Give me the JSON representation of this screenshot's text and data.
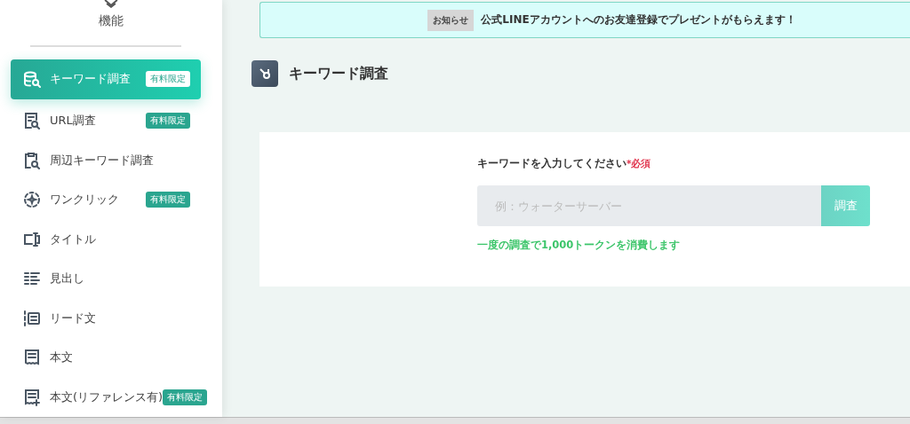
{
  "sidebar": {
    "heading": "機能",
    "items": [
      {
        "label": "キーワード調査",
        "badge": "有料限定",
        "selected": true
      },
      {
        "label": "URL調査",
        "badge": "有料限定",
        "selected": false
      },
      {
        "label": "周辺キーワード調査",
        "selected": false
      },
      {
        "label": "ワンクリック",
        "badge": "有料限定",
        "selected": false
      },
      {
        "label": "タイトル",
        "selected": false
      },
      {
        "label": "見出し",
        "selected": false
      },
      {
        "label": "リード文",
        "selected": false
      },
      {
        "label": "本文",
        "selected": false
      },
      {
        "label": "本文(リファレンス有)",
        "badge": "有料限定",
        "selected": false
      }
    ]
  },
  "notice": {
    "tag": "お知らせ",
    "text": "公式LINEアカウントへのお友達登録でプレゼントがもらえます！"
  },
  "page_title": "キーワード調査",
  "form": {
    "label": "キーワードを入力してください",
    "required": "*必須",
    "placeholder": "例：ウォーターサーバー",
    "button": "調査",
    "hint": "一度の調査で1,000トークンを消費します"
  }
}
